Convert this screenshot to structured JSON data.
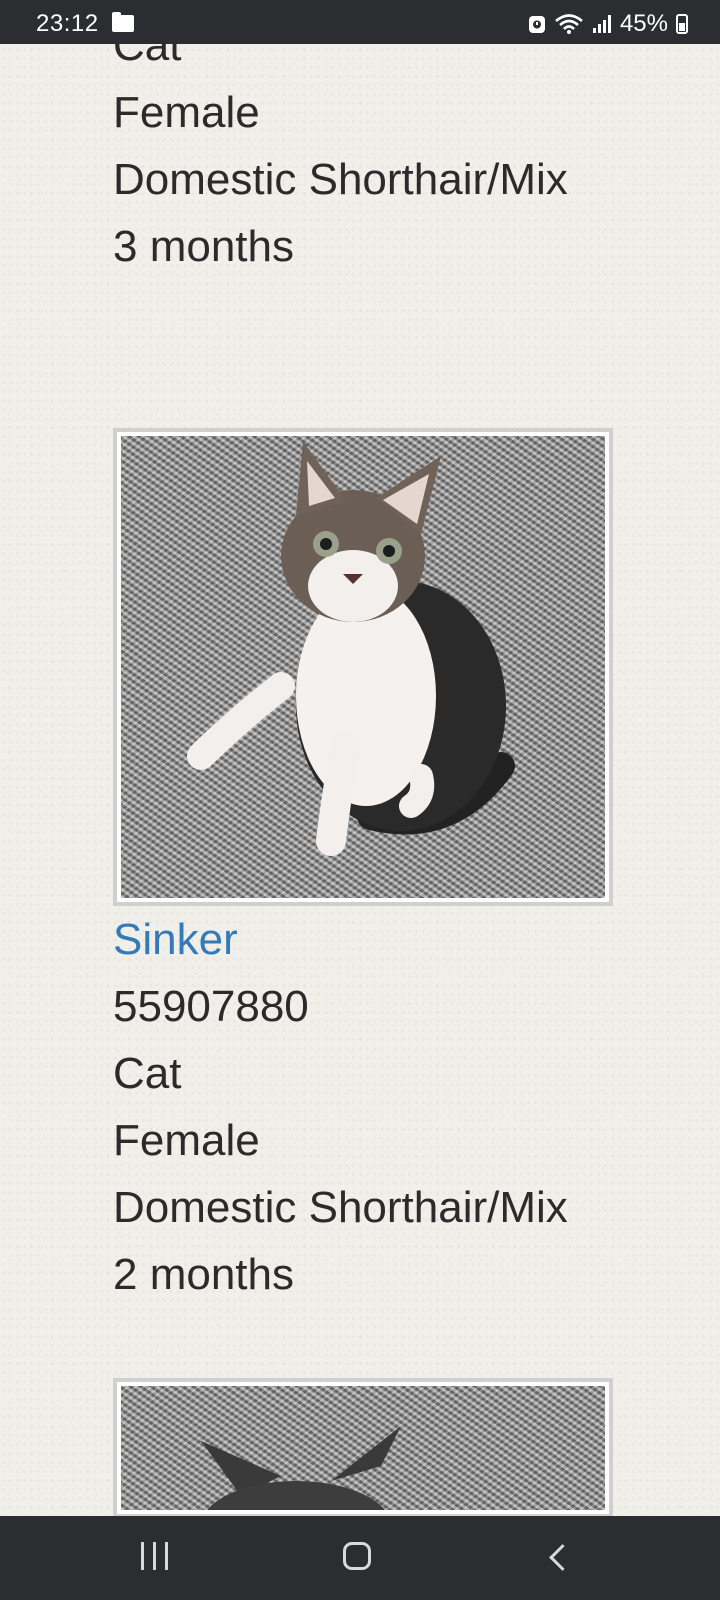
{
  "status_bar": {
    "time": "23:12",
    "battery": "45%",
    "icons": [
      "folder-icon",
      "alarm-icon",
      "wifi-icon",
      "signal-icon",
      "battery-icon"
    ]
  },
  "pets": [
    {
      "name": "",
      "species": "Cat",
      "sex": "Female",
      "breed": "Domestic Shorthair/Mix",
      "age": "3 months"
    },
    {
      "name": "Sinker",
      "id": "55907880",
      "species": "Cat",
      "sex": "Female",
      "breed": "Domestic Shorthair/Mix",
      "age": "2 months",
      "photo": "tabby-white-kitten-photo"
    },
    {
      "photo": "dark-kitten-photo"
    }
  ],
  "colors": {
    "link": "#337ab7",
    "text": "#2b2b2b",
    "bars": "#2b2d31"
  },
  "nav_bar": {
    "buttons": [
      "recents-button",
      "home-button",
      "back-button"
    ]
  }
}
